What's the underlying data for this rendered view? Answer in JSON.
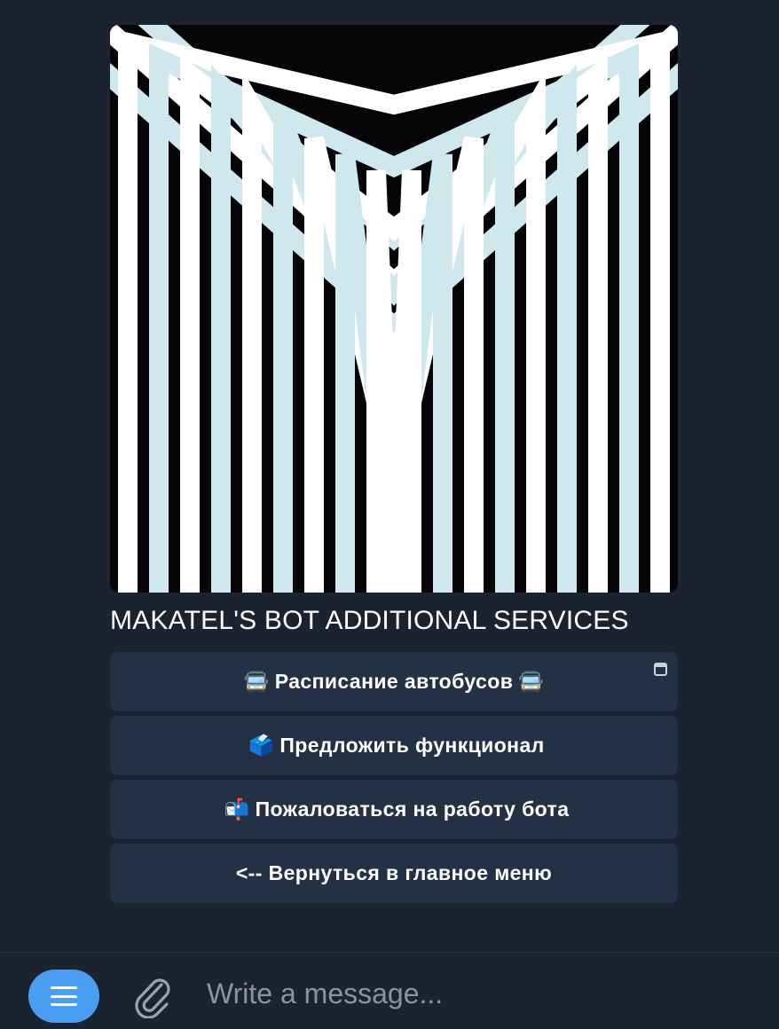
{
  "message": {
    "photo_name": "makatel logo",
    "caption": "MAKATEL'S BOT ADDITIONAL SERVICES",
    "buttons": [
      {
        "emoji_left": "🚍",
        "label": "Расписание автобусов",
        "emoji_right": "🚍",
        "webapp": true
      },
      {
        "emoji_left": "🗳️",
        "label": "Предложить функционал",
        "emoji_right": "",
        "webapp": false
      },
      {
        "emoji_left": "📬",
        "label": "Пожаловаться на работу бота",
        "emoji_right": "",
        "webapp": false
      },
      {
        "emoji_left": "",
        "label": "<-- Вернуться в главное меню",
        "emoji_right": "",
        "webapp": false
      }
    ]
  },
  "composer": {
    "placeholder": "Write a message...",
    "menu_icon": "menu-icon",
    "attach_icon": "paperclip-icon"
  },
  "colors": {
    "background": "#1c2330",
    "button": "#243145",
    "accent": "#4a9ef2"
  }
}
